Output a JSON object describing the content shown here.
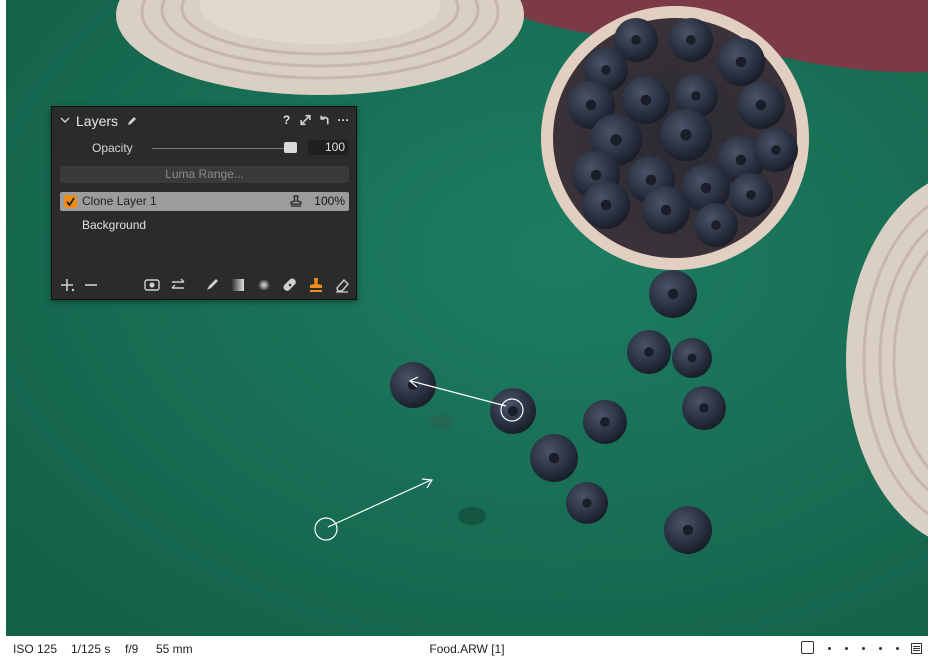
{
  "layers_panel": {
    "title": "Layers",
    "header_icons": [
      "pen-icon",
      "help-icon",
      "expand-icon",
      "undo-icon",
      "more-icon"
    ],
    "help_label": "?",
    "more_label": "···",
    "opacity_label": "Opacity",
    "opacity_value": "100",
    "opacity_level": 1.0,
    "luma_range_label": "Luma Range...",
    "layers": [
      {
        "name": "Clone Layer 1",
        "checked": true,
        "opacity": "100%",
        "selected": true
      },
      {
        "name": "Background",
        "checked": false,
        "opacity": "",
        "selected": false
      }
    ],
    "toolbar_icons": [
      "add-icon",
      "remove-icon",
      "eye-icon",
      "swap-icon",
      "brush-icon",
      "gradient-icon",
      "radial-icon",
      "heal-icon",
      "clone-stamp-icon",
      "eraser-icon"
    ],
    "active_tool": "clone-stamp-icon",
    "accent_color": "#f08c1a"
  },
  "status_bar": {
    "iso": "ISO 125",
    "shutter": "1/125 s",
    "aperture": "f/9",
    "focal_length": "55 mm",
    "filename": "Food.ARW [1]"
  },
  "photo": {
    "background_color": "#19735a"
  }
}
